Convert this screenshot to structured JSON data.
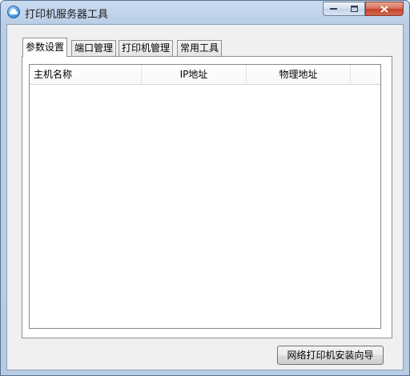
{
  "window": {
    "title": "打印机服务器工具"
  },
  "tabs": [
    {
      "label": "参数设置",
      "active": true
    },
    {
      "label": "端口管理",
      "active": false
    },
    {
      "label": "打印机管理",
      "active": false
    },
    {
      "label": "常用工具",
      "active": false
    }
  ],
  "table": {
    "columns": [
      "主机名称",
      "IP地址",
      "物理地址",
      ""
    ],
    "rows": []
  },
  "footer": {
    "wizard_button": "网络打印机安装向导"
  },
  "colors": {
    "titlebar": "#b9cde6",
    "close_button": "#c2432a",
    "client_bg": "#f0f0f0"
  }
}
